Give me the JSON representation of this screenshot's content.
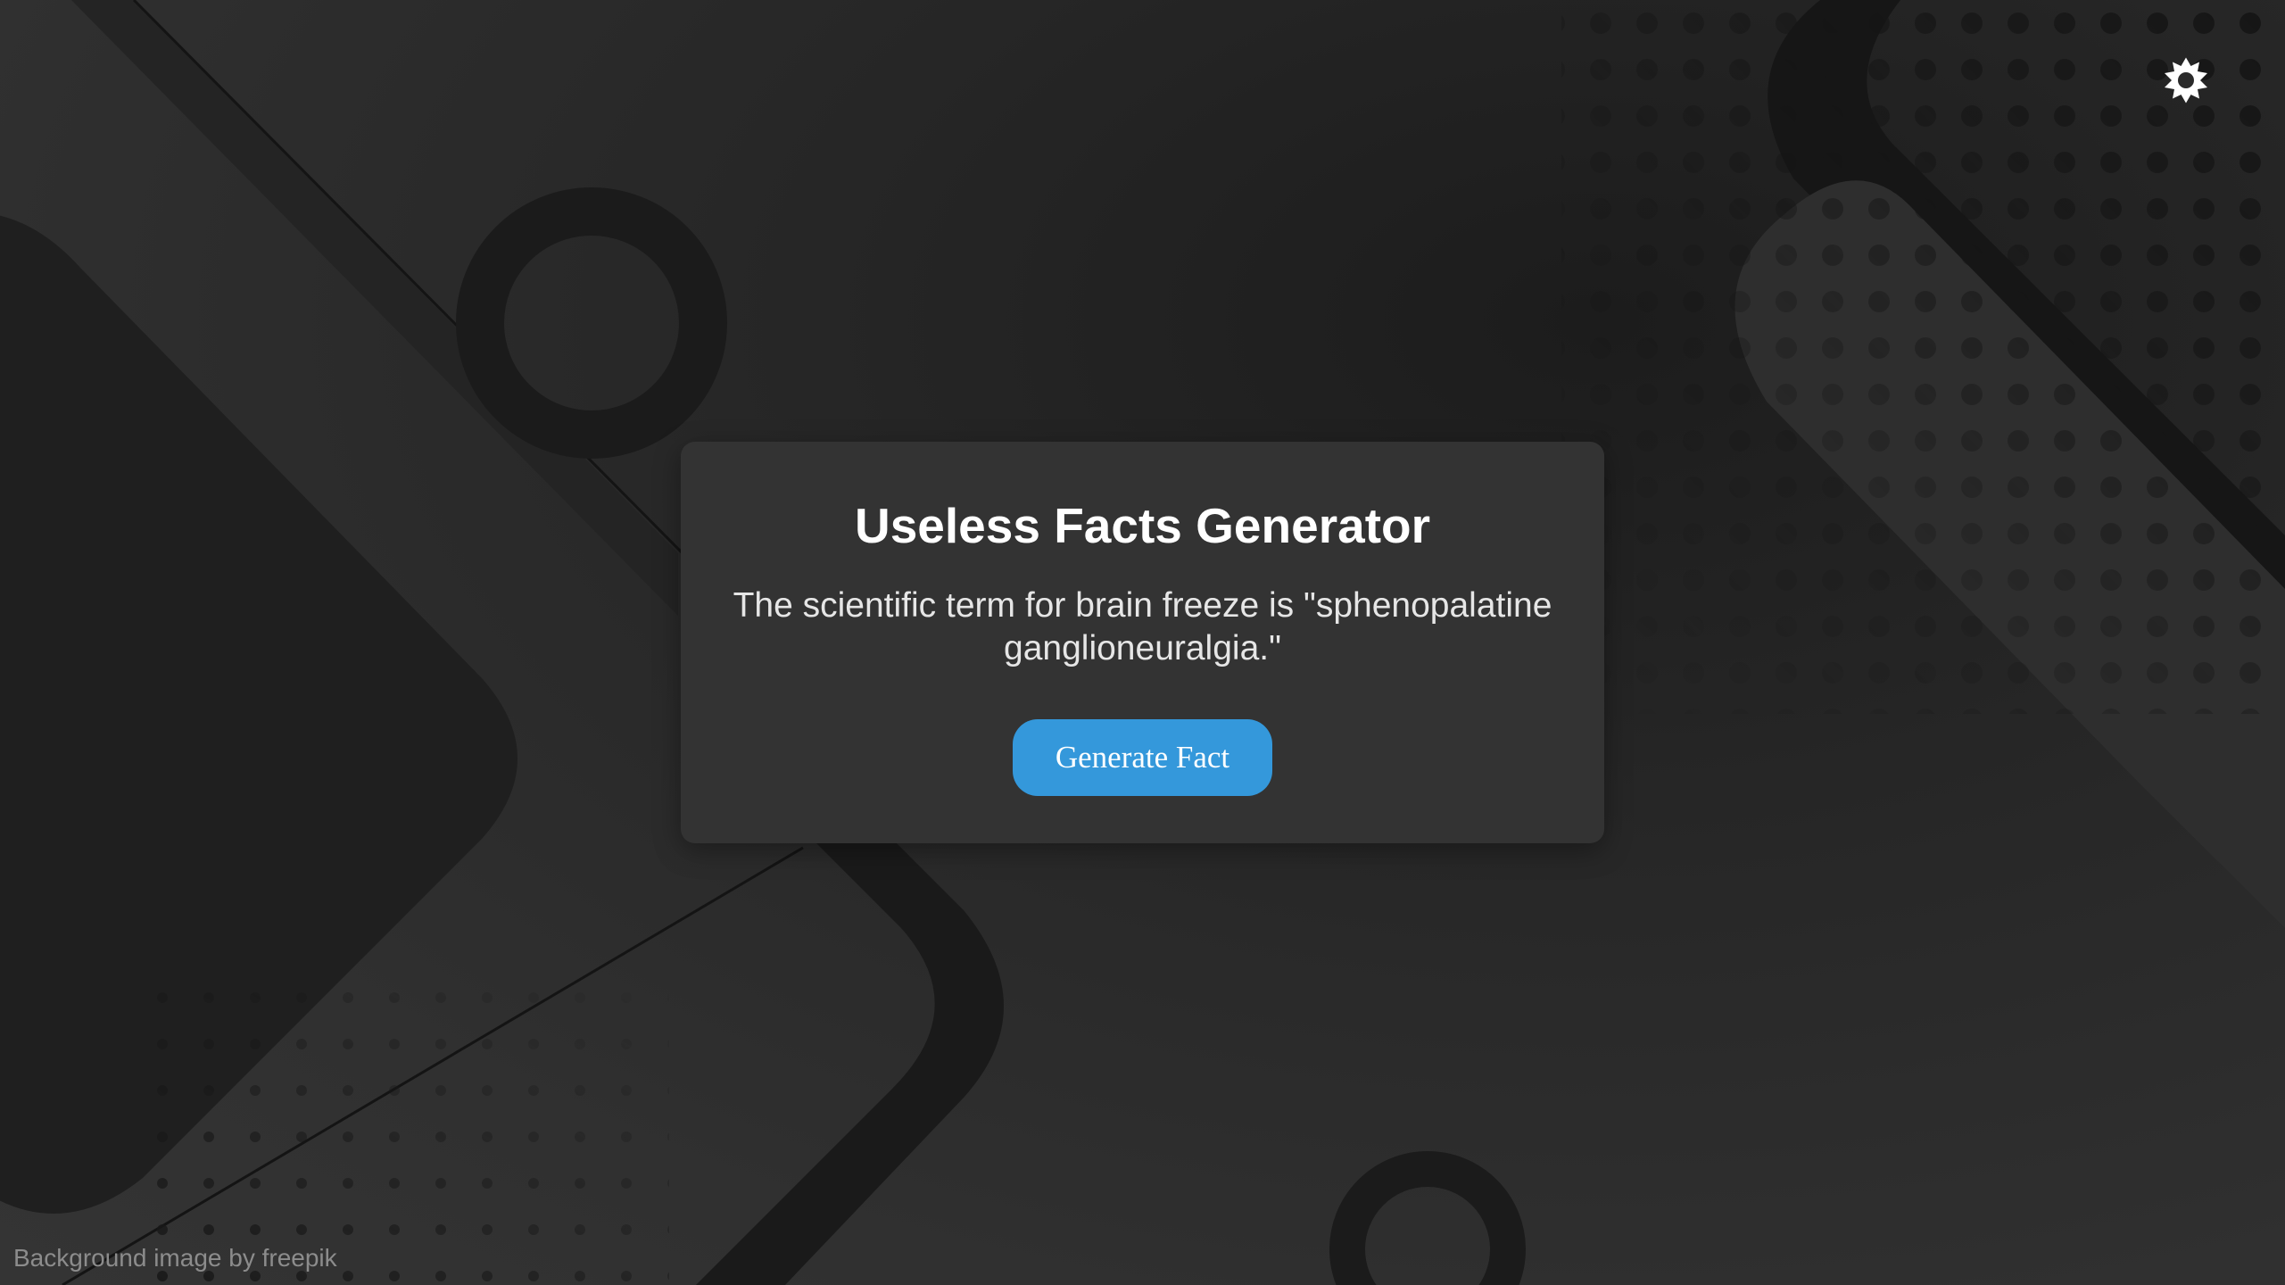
{
  "app": {
    "title": "Useless Facts Generator",
    "fact": "The scientific term for brain freeze is \"sphenopalatine ganglioneuralgia.\"",
    "generate_label": "Generate Fact",
    "credit": "Background image by freepik"
  },
  "icons": {
    "settings": "gear-icon"
  },
  "colors": {
    "accent": "#3498db",
    "card": "#333333",
    "background": "#2a2a2a"
  }
}
